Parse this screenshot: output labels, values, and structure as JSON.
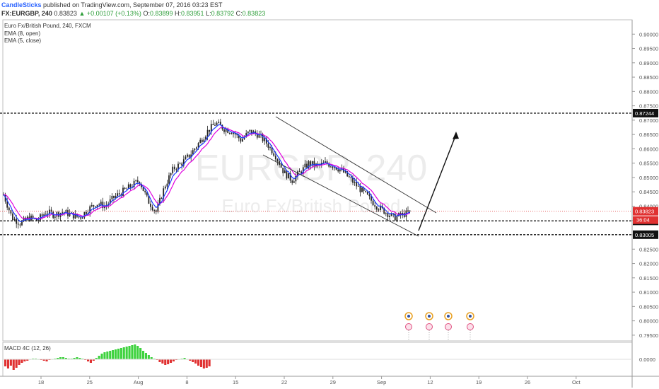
{
  "header": {
    "author": "CandleSticks",
    "published": "published on TradingView.com, September 07, 2016 03:23 EST",
    "symbol": "FX:EURGBP, 240",
    "last": "0.83823",
    "change": "+0.00107 (+0.13%)",
    "open_label": "O:",
    "open": "0.83899",
    "high_label": "H:",
    "high": "0.83951",
    "low_label": "L:",
    "low": "0.83792",
    "close_label": "C:",
    "close": "0.83823"
  },
  "legend": {
    "title": "Euro Fx/British Pound, 240, FXCM",
    "ema1": "EMA (8, open)",
    "ema2": "EMA (5, close)"
  },
  "watermark": {
    "symbol": "EURGBP, 240",
    "name": "Euro Fx/British Pound"
  },
  "macd_label": "MACD 4C (12, 26)",
  "colors": {
    "candle": "#222222",
    "ema_open": "#e000e0",
    "ema_close": "#1a3cff",
    "macd_positive": "#3dd23d",
    "macd_negative": "#e03131",
    "price_line": "#e03131"
  },
  "chart_data": {
    "type": "candlestick",
    "ylim": [
      0.793,
      0.905
    ],
    "y_ticks": [
      "0.90000",
      "0.89500",
      "0.89000",
      "0.88500",
      "0.88000",
      "0.87500",
      "0.87000",
      "0.86500",
      "0.86000",
      "0.85500",
      "0.85000",
      "0.84500",
      "0.84000",
      "0.83500",
      "0.83000",
      "0.82500",
      "0.82000",
      "0.81500",
      "0.81000",
      "0.80500",
      "0.80000",
      "0.79500"
    ],
    "x_ticks": [
      "18",
      "25",
      "Aug",
      "8",
      "15",
      "22",
      "29",
      "Sep",
      "12",
      "19",
      "26",
      "Oct"
    ],
    "horizontal_levels": [
      {
        "value": 0.87244,
        "label": "0.87244"
      },
      {
        "value": 0.83486,
        "label": "0.83486"
      },
      {
        "value": 0.83005,
        "label": "0.83005"
      }
    ],
    "current_price": {
      "value": 0.83823,
      "label": "0.83823",
      "countdown": "36:04"
    },
    "price_path": [
      [
        0,
        0.844
      ],
      [
        4,
        0.836
      ],
      [
        8,
        0.834
      ],
      [
        12,
        0.836
      ],
      [
        16,
        0.835
      ],
      [
        20,
        0.838
      ],
      [
        24,
        0.837
      ],
      [
        28,
        0.838
      ],
      [
        32,
        0.837
      ],
      [
        36,
        0.836
      ],
      [
        40,
        0.839
      ],
      [
        44,
        0.841
      ],
      [
        48,
        0.84
      ],
      [
        52,
        0.843
      ],
      [
        56,
        0.845
      ],
      [
        60,
        0.847
      ],
      [
        64,
        0.849
      ],
      [
        68,
        0.842
      ],
      [
        72,
        0.838
      ],
      [
        76,
        0.847
      ],
      [
        80,
        0.853
      ],
      [
        84,
        0.855
      ],
      [
        88,
        0.858
      ],
      [
        92,
        0.862
      ],
      [
        96,
        0.866
      ],
      [
        100,
        0.869
      ],
      [
        104,
        0.867
      ],
      [
        108,
        0.866
      ],
      [
        112,
        0.863
      ],
      [
        116,
        0.866
      ],
      [
        120,
        0.865
      ],
      [
        124,
        0.862
      ],
      [
        128,
        0.858
      ],
      [
        132,
        0.852
      ],
      [
        136,
        0.849
      ],
      [
        140,
        0.852
      ],
      [
        144,
        0.855
      ],
      [
        148,
        0.854
      ],
      [
        152,
        0.855
      ],
      [
        156,
        0.854
      ],
      [
        160,
        0.852
      ],
      [
        164,
        0.849
      ],
      [
        168,
        0.846
      ],
      [
        172,
        0.843
      ],
      [
        176,
        0.84
      ],
      [
        180,
        0.838
      ],
      [
        184,
        0.836
      ],
      [
        188,
        0.837
      ],
      [
        192,
        0.838
      ]
    ],
    "macd": [
      -1.0,
      -1.3,
      -0.9,
      -1.5,
      -1.2,
      -0.8,
      -0.5,
      -0.3,
      -0.2,
      0.0,
      0.1,
      0.1,
      0.0,
      -0.1,
      -0.2,
      -0.3,
      -0.1,
      0.0,
      0.1,
      0.2,
      0.3,
      0.3,
      0.2,
      0.1,
      0.1,
      0.2,
      0.3,
      0.2,
      0.1,
      -0.1,
      -0.3,
      -0.5,
      -0.2,
      0.2,
      0.5,
      0.8,
      1.0,
      1.1,
      1.2,
      1.3,
      1.4,
      1.5,
      1.6,
      1.7,
      1.8,
      1.9,
      2.0,
      2.1,
      1.9,
      1.6,
      1.2,
      0.9,
      0.6,
      0.3,
      0.1,
      -0.1,
      -0.4,
      -0.6,
      -0.8,
      -0.7,
      -0.5,
      -0.3,
      -0.1,
      0.0,
      0.1,
      0.2,
      0.0,
      -0.2,
      -0.4,
      -0.6,
      -0.9,
      -1.1,
      -1.3,
      -1.2,
      -1.0
    ],
    "annotations": {
      "channel": [
        {
          "from": [
            0.87,
            "Aug 18"
          ],
          "to": [
            0.8385,
            "Sep 13"
          ]
        },
        {
          "from": [
            0.8575,
            "Aug 16"
          ],
          "to": [
            0.8305,
            "Sep 08"
          ]
        }
      ],
      "forecast_arrow": "up"
    }
  }
}
